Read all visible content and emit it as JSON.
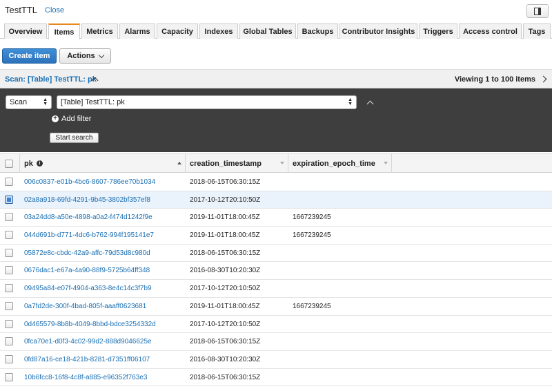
{
  "window": {
    "title": "TestTTL",
    "close_label": "Close"
  },
  "tabs": [
    {
      "label": "Overview"
    },
    {
      "label": "Items",
      "active": true
    },
    {
      "label": "Metrics"
    },
    {
      "label": "Alarms"
    },
    {
      "label": "Capacity"
    },
    {
      "label": "Indexes"
    },
    {
      "label": "Global Tables"
    },
    {
      "label": "Backups"
    },
    {
      "label": "Contributor Insights"
    },
    {
      "label": "Triggers"
    },
    {
      "label": "Access control"
    },
    {
      "label": "Tags"
    }
  ],
  "toolbar": {
    "create_label": "Create item",
    "actions_label": "Actions"
  },
  "scan": {
    "title": "Scan: [Table] TestTTL: pk",
    "viewing": "Viewing 1 to 100 items",
    "mode": "Scan",
    "target": "[Table] TestTTL: pk",
    "add_filter": "Add filter",
    "start_search": "Start search"
  },
  "table": {
    "columns": [
      "pk",
      "creation_timestamp",
      "expiration_epoch_time"
    ],
    "rows": [
      {
        "pk": "006c0837-e01b-4bc6-8607-786ee70b1034",
        "creation_timestamp": "2018-06-15T06:30:15Z",
        "expiration_epoch_time": "",
        "selected": false
      },
      {
        "pk": "02a8a918-69fd-4291-9b45-3802bf357ef8",
        "creation_timestamp": "2017-10-12T20:10:50Z",
        "expiration_epoch_time": "",
        "selected": true
      },
      {
        "pk": "03a24dd8-a50e-4898-a0a2-f474d1242f9e",
        "creation_timestamp": "2019-11-01T18:00:45Z",
        "expiration_epoch_time": "1667239245",
        "selected": false
      },
      {
        "pk": "044d691b-d771-4dc6-b762-994f195141e7",
        "creation_timestamp": "2019-11-01T18:00:45Z",
        "expiration_epoch_time": "1667239245",
        "selected": false
      },
      {
        "pk": "05872e8c-cbdc-42a9-affc-79d53d8c980d",
        "creation_timestamp": "2018-06-15T06:30:15Z",
        "expiration_epoch_time": "",
        "selected": false
      },
      {
        "pk": "0676dac1-e67a-4a90-88f9-5725b64ff348",
        "creation_timestamp": "2016-08-30T10:20:30Z",
        "expiration_epoch_time": "",
        "selected": false
      },
      {
        "pk": "09495a84-e07f-4904-a363-8e4c14c3f7b9",
        "creation_timestamp": "2017-10-12T20:10:50Z",
        "expiration_epoch_time": "",
        "selected": false
      },
      {
        "pk": "0a7fd2de-300f-4bad-805f-aaaff0623681",
        "creation_timestamp": "2019-11-01T18:00:45Z",
        "expiration_epoch_time": "1667239245",
        "selected": false
      },
      {
        "pk": "0d465579-8b8b-4049-8bbd-bdce3254332d",
        "creation_timestamp": "2017-10-12T20:10:50Z",
        "expiration_epoch_time": "",
        "selected": false
      },
      {
        "pk": "0fca70e1-d0f3-4c02-99d2-888d9046625e",
        "creation_timestamp": "2018-06-15T06:30:15Z",
        "expiration_epoch_time": "",
        "selected": false
      },
      {
        "pk": "0fd87a16-ce18-421b-8281-d7351ff06107",
        "creation_timestamp": "2016-08-30T10:20:30Z",
        "expiration_epoch_time": "",
        "selected": false
      },
      {
        "pk": "10b6fcc8-16f8-4c8f-a885-e96352f763e3",
        "creation_timestamp": "2018-06-15T06:30:15Z",
        "expiration_epoch_time": "",
        "selected": false
      }
    ]
  }
}
